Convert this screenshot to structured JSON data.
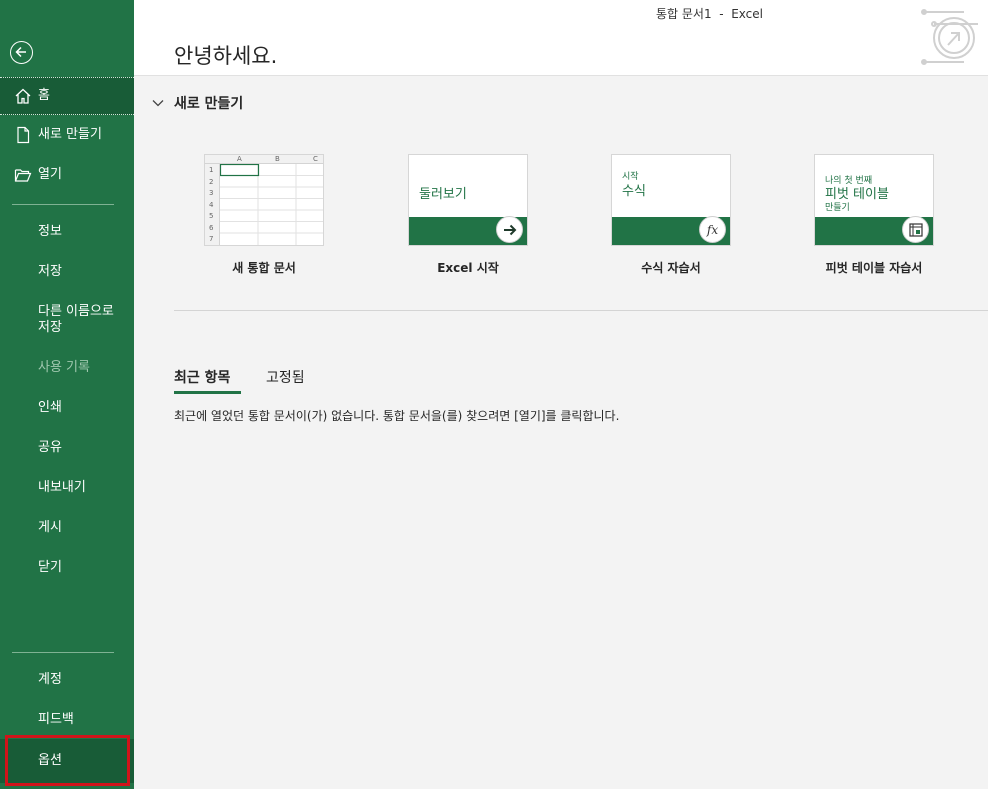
{
  "window": {
    "title": "통합 문서1  -  Excel"
  },
  "header": {
    "greeting": "안녕하세요."
  },
  "sidebar": {
    "home": "홈",
    "new": "새로 만들기",
    "open": "열기",
    "info": "정보",
    "save": "저장",
    "save_as_line1": "다른 이름으로",
    "save_as_line2": "저장",
    "history": "사용 기록",
    "print": "인쇄",
    "share": "공유",
    "export": "내보내기",
    "publish": "게시",
    "close": "닫기",
    "account": "계정",
    "feedback": "피드백",
    "options": "옵션"
  },
  "new_section": {
    "title": "새로 만들기",
    "tiles": [
      {
        "label": "새 통합 문서"
      },
      {
        "label": "Excel 시작",
        "thumb_text": "둘러보기"
      },
      {
        "label": "수식 자습서",
        "thumb_small": "시작",
        "thumb_text": "수식"
      },
      {
        "label": "피벗 테이블 자습서",
        "thumb_small": "나의 첫 번째",
        "thumb_text": "피벗 테이블",
        "thumb_sub": "만들기"
      }
    ],
    "grid": {
      "cols": [
        "A",
        "B",
        "C"
      ],
      "rows": [
        "1",
        "2",
        "3",
        "4",
        "5",
        "6",
        "7"
      ]
    }
  },
  "recent": {
    "tab_recent": "최근 항목",
    "tab_pinned": "고정됨",
    "empty_message": "최근에 열었던 통합 문서이(가) 없습니다. 통합 문서을(를) 찾으려면 [열기]를 클릭합니다."
  },
  "colors": {
    "accent": "#217346",
    "accent_dark": "#185c37",
    "highlight": "#d0141a"
  }
}
